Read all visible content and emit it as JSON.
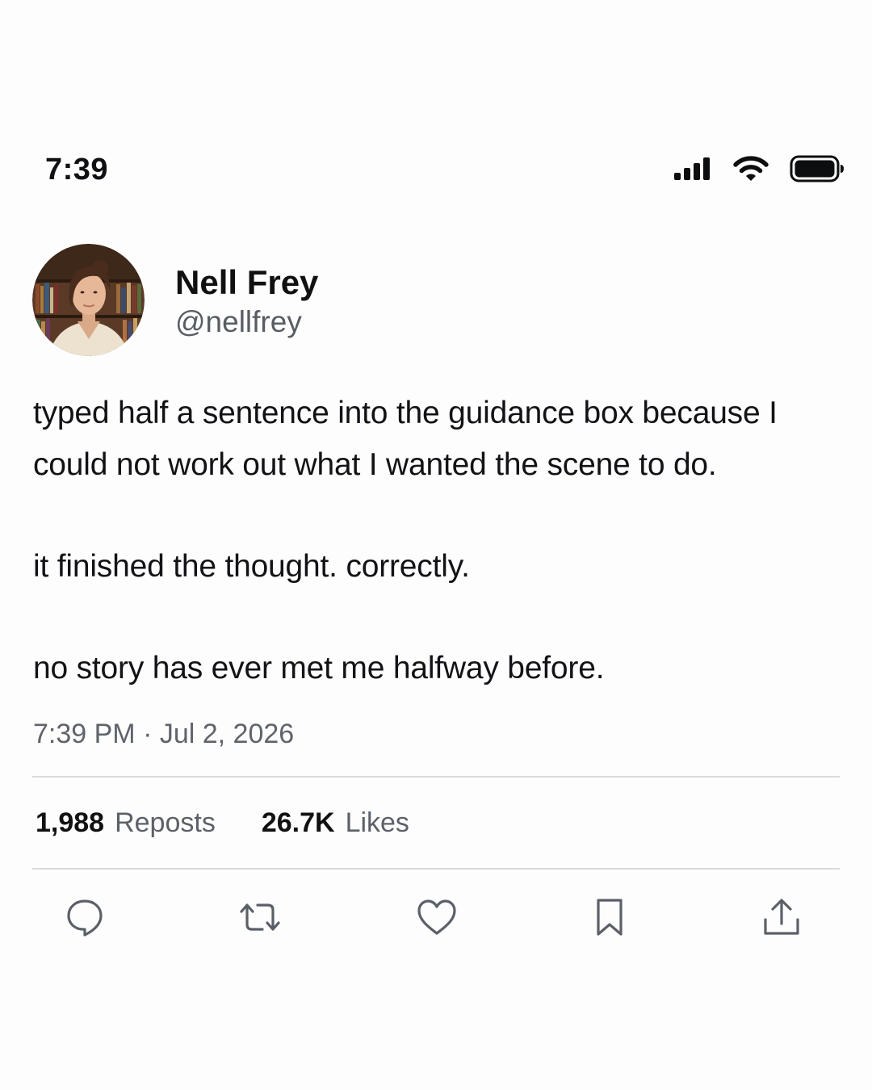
{
  "status_bar": {
    "time": "7:39",
    "icons": [
      "cellular-signal-icon",
      "wifi-icon",
      "battery-icon"
    ]
  },
  "author": {
    "display_name": "Nell Frey",
    "handle": "@nellfrey"
  },
  "tweet": {
    "paragraphs": [
      "typed half a sentence into the guidance box because I could not work out what I wanted the scene to do.",
      "it finished the thought. correctly.",
      "no story has ever met me halfway before."
    ],
    "timestamp": "7:39 PM · Jul 2, 2026"
  },
  "stats": {
    "reposts_count": "1,988",
    "reposts_label": "Reposts",
    "likes_count": "26.7K",
    "likes_label": "Likes"
  },
  "actions": [
    "reply-icon",
    "repost-icon",
    "like-icon",
    "bookmark-icon",
    "share-icon"
  ],
  "colors": {
    "background": "#fdfdfd",
    "text_primary": "#121316",
    "text_secondary": "#5f646b",
    "divider": "#d9dadc",
    "icon": "#5b6068"
  }
}
